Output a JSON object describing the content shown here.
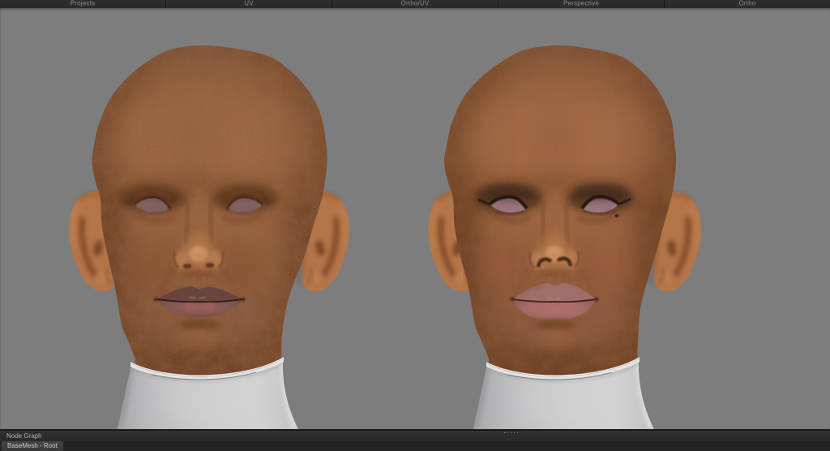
{
  "tab_bar": {
    "tabs": [
      {
        "label": "Projects"
      },
      {
        "label": "UV"
      },
      {
        "label": "Ortho/UV"
      },
      {
        "label": "Perspective"
      },
      {
        "label": "Ortho"
      }
    ]
  },
  "viewport": {
    "description": "3D perspective viewport showing two bald head busts on white collar bases",
    "heads": [
      {
        "id": "left-head",
        "skin": "mottled tan-brown, plain mauve closed eyes"
      },
      {
        "id": "right-head",
        "skin": "smooth tan-brown, dark eyeliner, mole under right eye"
      }
    ]
  },
  "node_graph": {
    "title": "Node Graph",
    "active_tab": "BaseMesh - Root"
  },
  "colors": {
    "viewport-bg": "#7d7d7d",
    "tabbar-bg": "#202020",
    "tab-bg": "#2c2c2c",
    "tab-text": "#8f8f8f",
    "ng-row-bg": "#232323",
    "ng-title-text": "#b2b2b2",
    "ng-tab-text": "#cbcbcb",
    "skin-base": "#9d6240",
    "skin-shadow": "#7a4527",
    "skin-light": "#c38a5b",
    "collar-light": "#dcdcdd",
    "collar-dark": "#b2b2b4"
  }
}
